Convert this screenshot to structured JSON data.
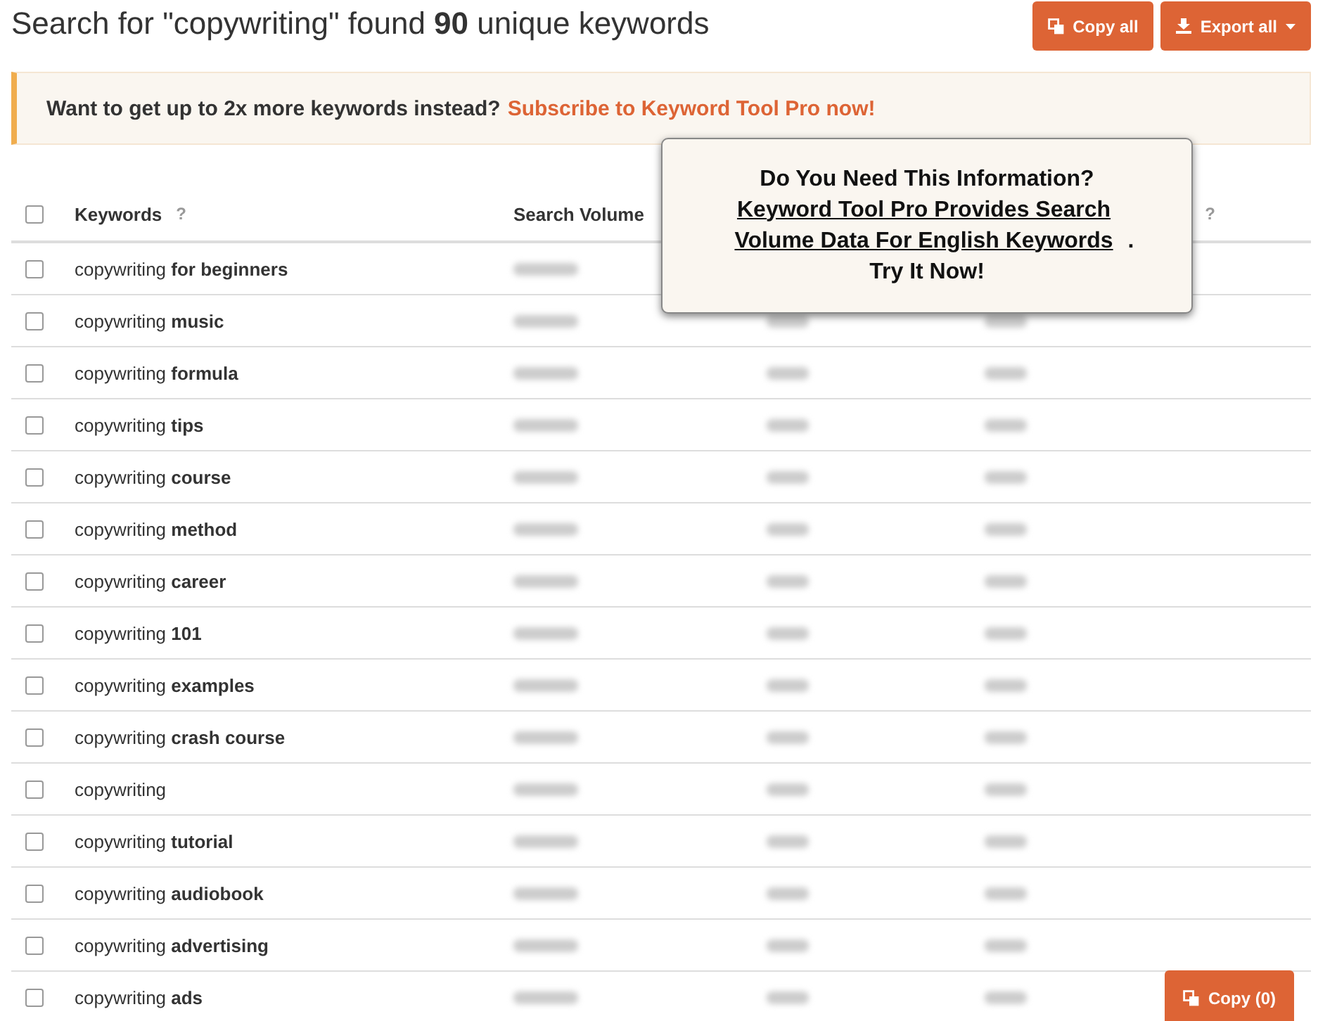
{
  "heading": "Search for \"copywriting\" found **90** unique keywords",
  "actions": [
    {
      "label": "Copy all",
      "kind": "copy"
    },
    {
      "label": "Export all",
      "kind": "export"
    }
  ],
  "banner": {
    "text": "Want to get up to 2x more keywords instead?",
    "link": "Subscribe to Keyword Tool Pro now!"
  },
  "table": {
    "select_all": {
      "checked": false
    },
    "columns": [
      {
        "label": "Keywords",
        "help": "?"
      },
      {
        "label": "Search Volume"
      },
      {},
      {
        "help": "?"
      }
    ],
    "rows": [
      {
        "keyword": "copywriting **for beginners**",
        "checked": false
      },
      {
        "keyword": "copywriting **music**",
        "checked": false
      },
      {
        "keyword": "copywriting **formula**",
        "checked": false
      },
      {
        "keyword": "copywriting **tips**",
        "checked": false
      },
      {
        "keyword": "copywriting **course**",
        "checked": false
      },
      {
        "keyword": "copywriting **method**",
        "checked": false
      },
      {
        "keyword": "copywriting **career**",
        "checked": false
      },
      {
        "keyword": "copywriting **101**",
        "checked": false
      },
      {
        "keyword": "copywriting **examples**",
        "checked": false
      },
      {
        "keyword": "copywriting **crash course**",
        "checked": false
      },
      {
        "keyword": "copywriting",
        "checked": false
      },
      {
        "keyword": "copywriting **tutorial**",
        "checked": false
      },
      {
        "keyword": "copywriting **audiobook**",
        "checked": false
      },
      {
        "keyword": "copywriting **advertising**",
        "checked": false
      },
      {
        "keyword": "copywriting **ads**",
        "checked": false
      }
    ]
  },
  "popup": {
    "title": "Do You Need This Information?",
    "link": "Keyword Tool Pro Provides Search Volume Data For English Keywords",
    "link_suffix": ".",
    "cta": "Try It Now!"
  },
  "copy_button": {
    "label": "Copy (0)"
  }
}
